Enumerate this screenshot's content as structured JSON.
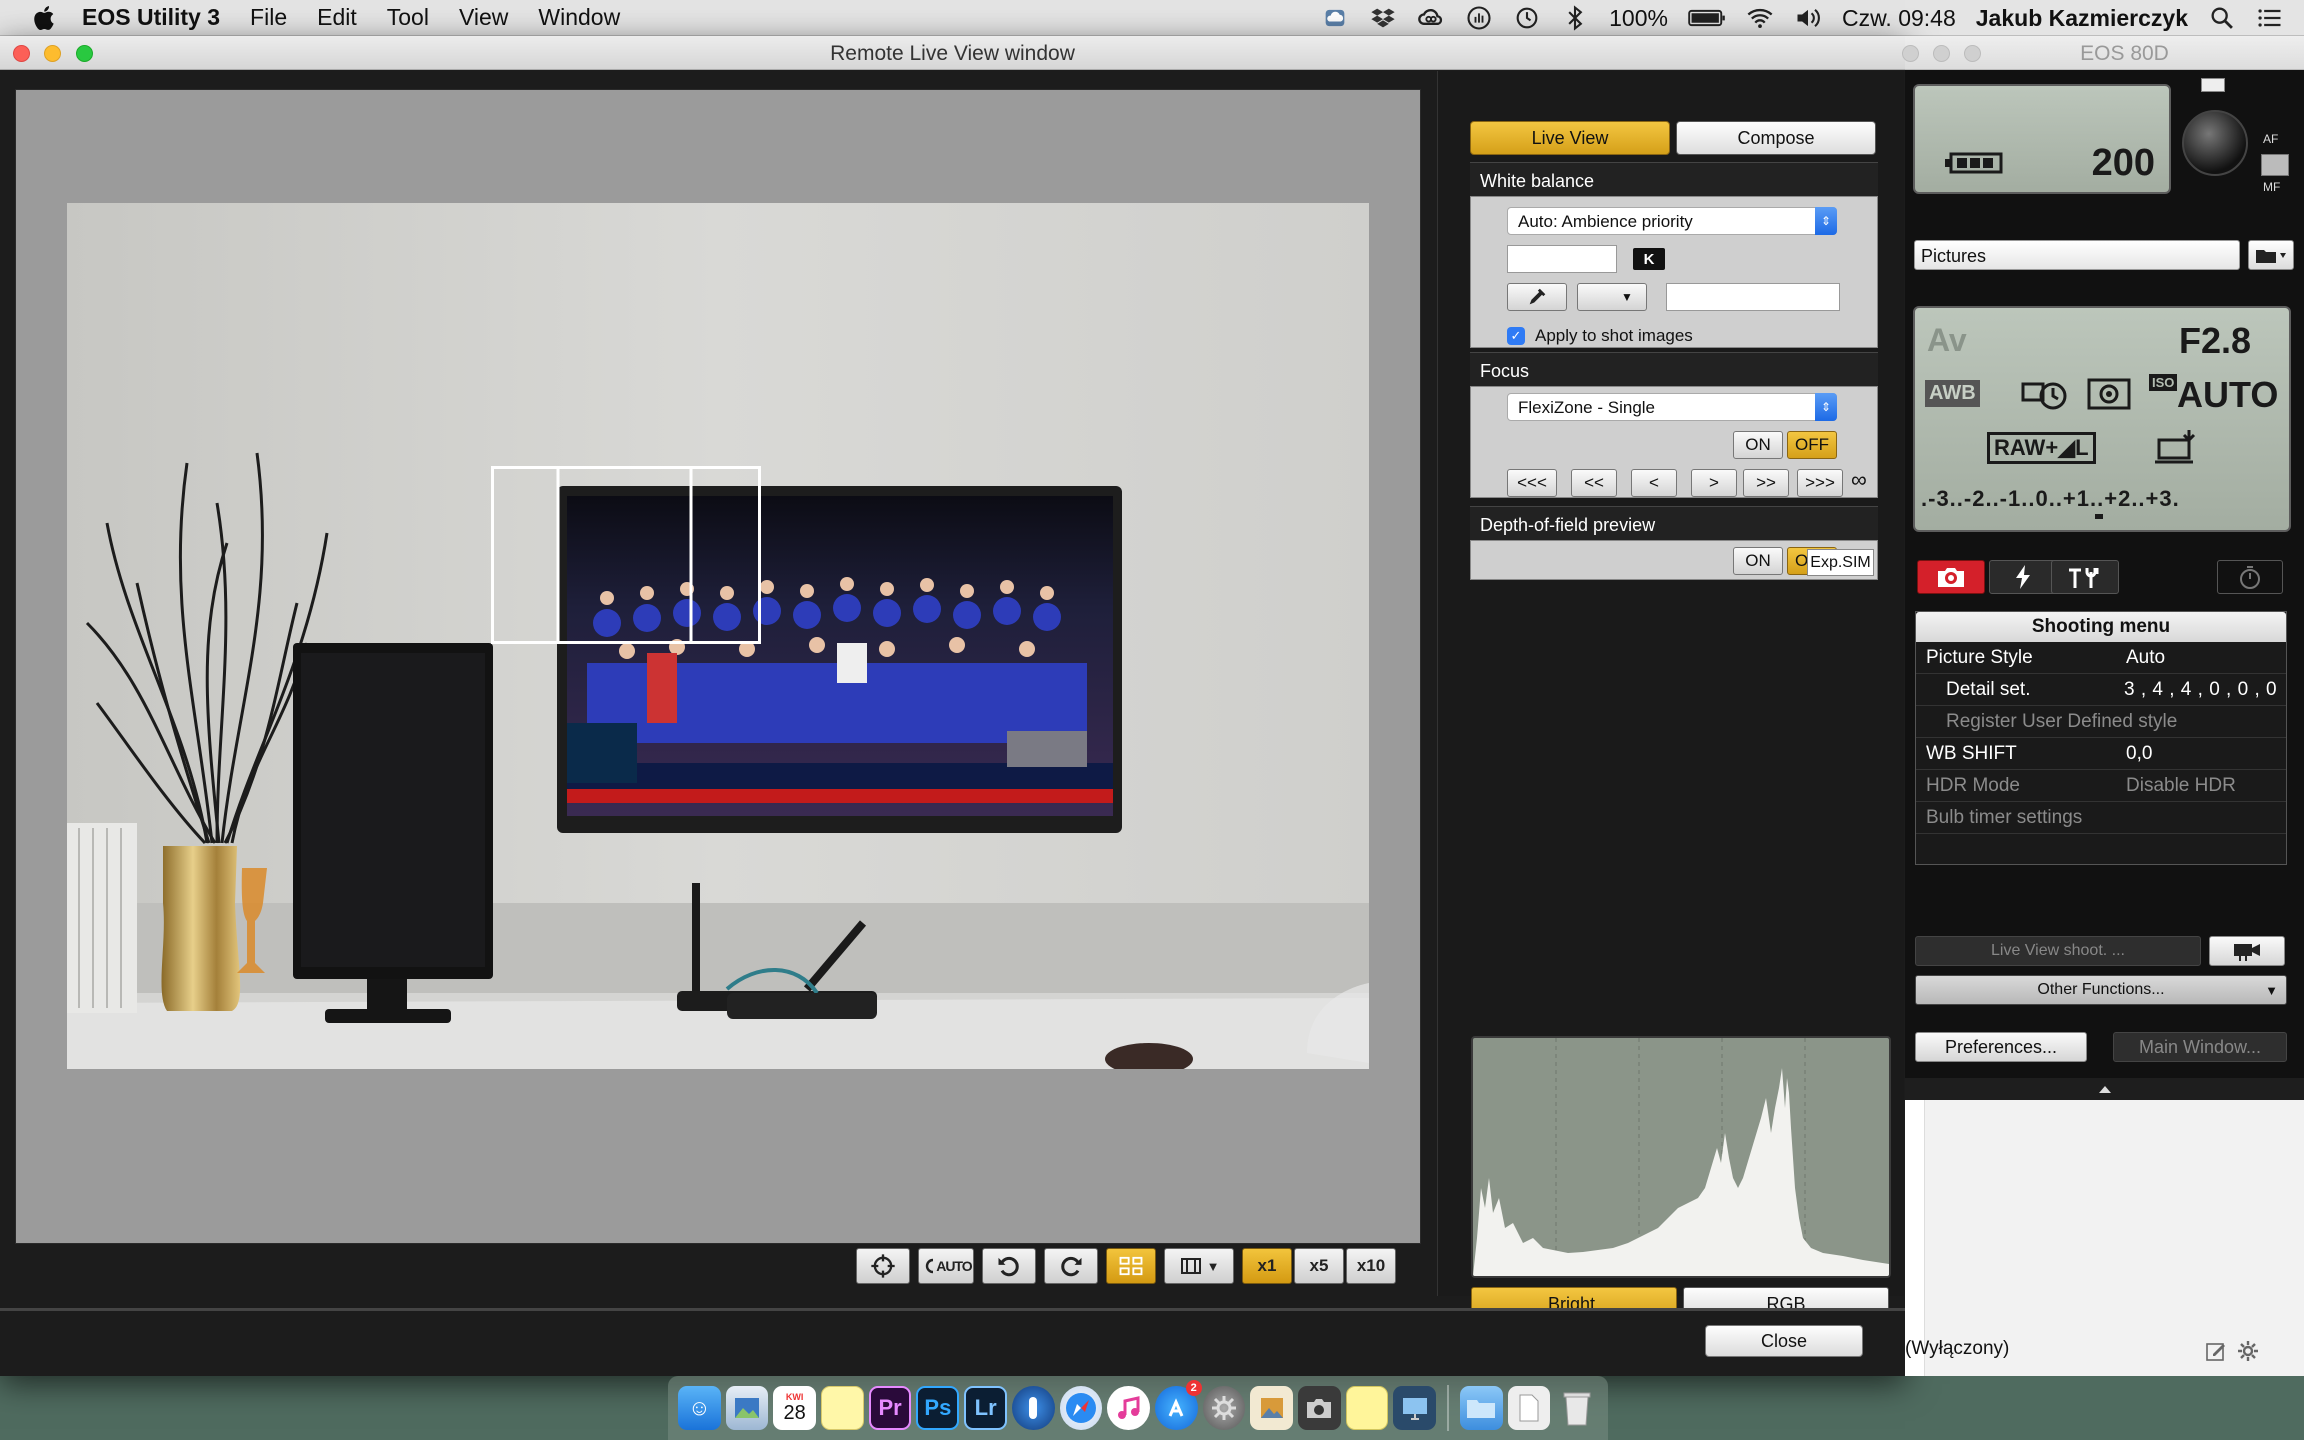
{
  "menubar": {
    "app_name": "EOS Utility 3",
    "items": [
      "File",
      "Edit",
      "Tool",
      "View",
      "Window"
    ],
    "battery": "100%",
    "clock": "Czw. 09:48",
    "user": "Jakub Kazmierczyk"
  },
  "main_window": {
    "title": "Remote Live View window",
    "close_label": "Close"
  },
  "toolbar": {
    "auto_label": "AUTO",
    "zoom": [
      "x1",
      "x5",
      "x10"
    ],
    "active_zoom": "x1"
  },
  "panel": {
    "tabs": [
      "Live View",
      "Compose"
    ],
    "active_tab": "Live View",
    "white_balance": {
      "heading": "White balance",
      "mode": "Auto: Ambience priority",
      "kelvin_badge": "K",
      "apply_label": "Apply to shot images",
      "apply_checked": true
    },
    "focus": {
      "heading": "Focus",
      "mode": "FlexiZone - Single",
      "on": "ON",
      "off": "OFF",
      "steps": [
        "<<<",
        "<<",
        "<",
        ">",
        ">>",
        ">>>"
      ],
      "infinity": "∞"
    },
    "dof": {
      "heading": "Depth-of-field preview",
      "on": "ON",
      "off": "OFF"
    },
    "expsim": "Exp.SIM",
    "histogram_buttons": [
      "Bright.",
      "RGB"
    ],
    "active_histogram": "Bright."
  },
  "camera": {
    "title": "EOS 80D",
    "iso_top": "200",
    "folder": "Pictures",
    "mode": "Av",
    "aperture": "F2.8",
    "awb": "AWB",
    "iso_label": "ISO",
    "iso": "AUTO",
    "quality": "RAW+◢L",
    "exposure_scale": ".-3..-2..-1..0..+1..+2..+3.",
    "af_label": "AF",
    "mf_label": "MF",
    "menu": {
      "title": "Shooting menu",
      "rows": [
        {
          "key": "Picture Style",
          "value": "Auto",
          "dim": false,
          "indent": false
        },
        {
          "key": "Detail set.",
          "value": "3 , 4 , 4 , 0 , 0 , 0",
          "dim": false,
          "indent": true
        },
        {
          "key": "Register User Defined style",
          "value": "",
          "dim": true,
          "indent": true
        },
        {
          "key": "WB SHIFT",
          "value": "0,0",
          "dim": false,
          "indent": false
        },
        {
          "key": "HDR Mode",
          "value": "Disable HDR",
          "dim": true,
          "indent": false
        },
        {
          "key": "Bulb timer settings",
          "value": "",
          "dim": true,
          "indent": false
        }
      ]
    },
    "live_view_shoot": "Live View shoot. ...",
    "other_functions": "Other Functions...",
    "preferences": "Preferences...",
    "main_window": "Main Window...",
    "status": "(Wyłączony)"
  },
  "dock": {
    "calendar_month": "KWI",
    "calendar_day": "28",
    "appstore_badge": "2",
    "apps": [
      "Pr",
      "Ps",
      "Lr"
    ]
  },
  "colors": {
    "accent_yellow": "#e8b326",
    "window_dark": "#1c1c1c",
    "lcd_green": "#b3bdb1",
    "canon_red": "#d4202a"
  }
}
